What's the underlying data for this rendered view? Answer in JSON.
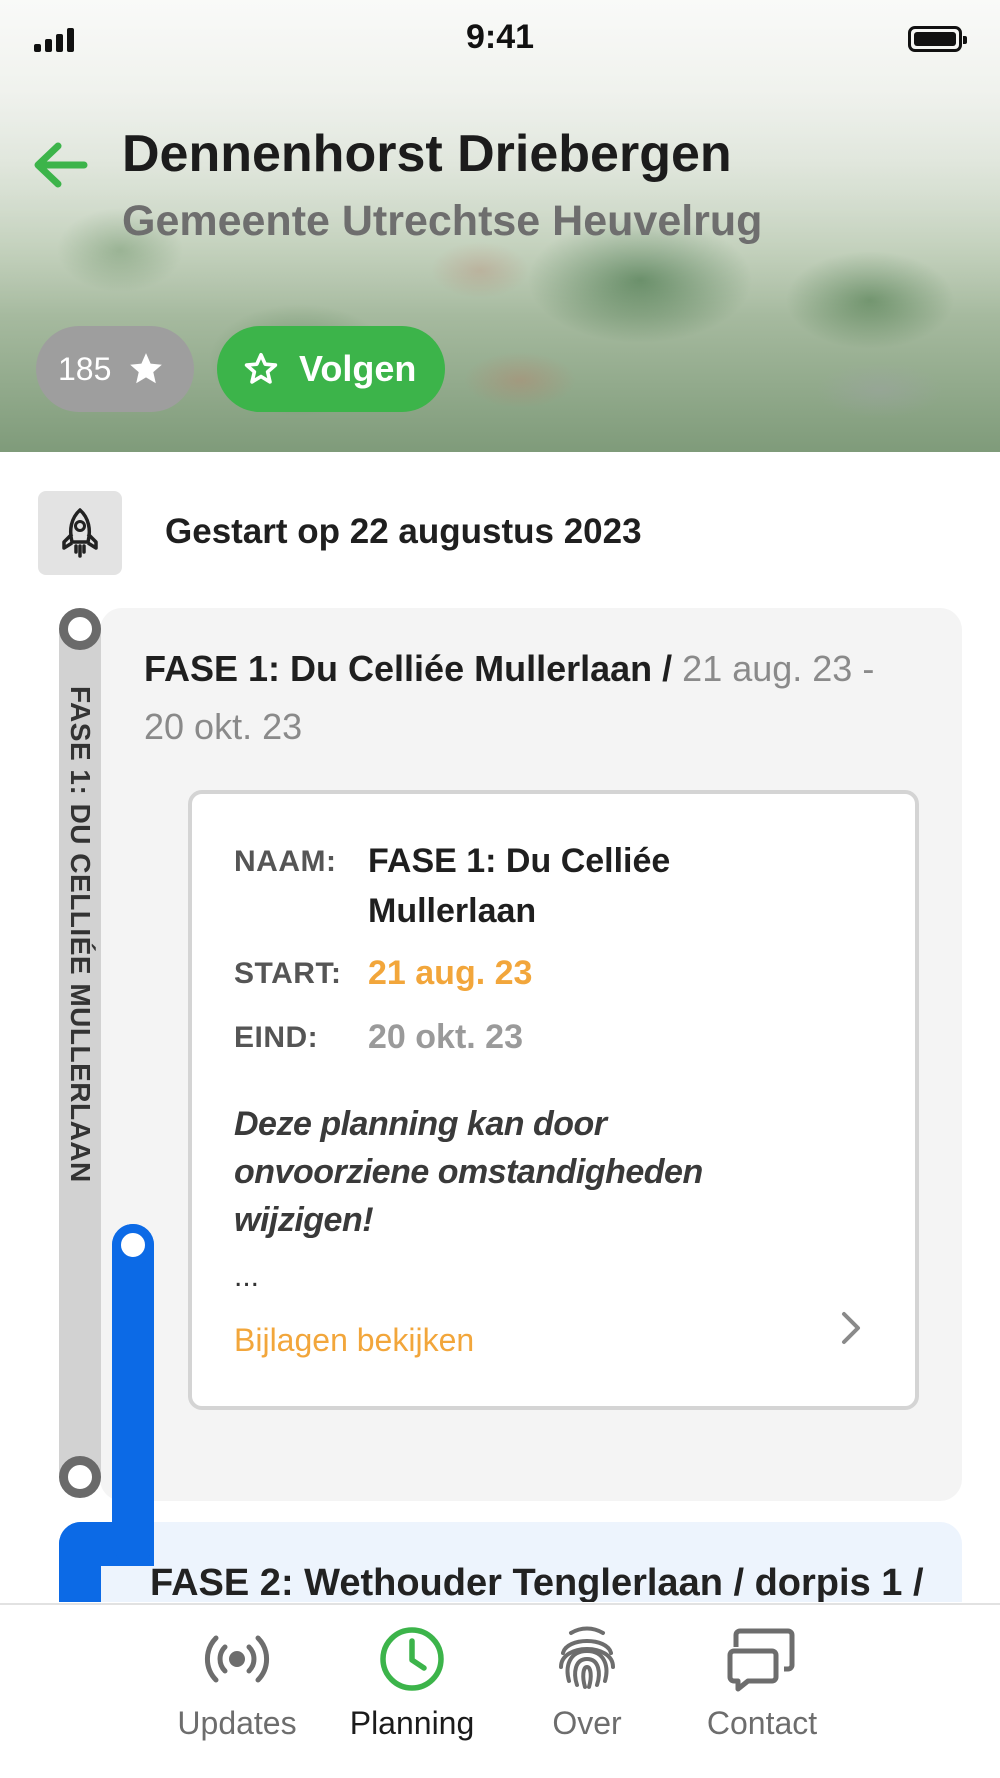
{
  "status_bar": {
    "time": "9:41"
  },
  "header": {
    "title": "Dennenhorst Driebergen",
    "subtitle": "Gemeente Utrechtse Heuvelrug",
    "followers_count": "185",
    "follow_label": "Volgen"
  },
  "started": {
    "text": "Gestart op 22 augustus 2023"
  },
  "phase": {
    "rail_label": "FASE 1: DU CELLIÉE MULLERLAAN",
    "heading_name": "FASE 1: Du Celliée Mullerlaan /",
    "heading_dates": "21 aug. 23 - 20 okt. 23",
    "detail": {
      "name_label": "NAAM:",
      "name_value": "FASE 1: Du Celliée Mullerlaan",
      "start_label": "START:",
      "start_value": "21 aug. 23",
      "end_label": "EIND:",
      "end_value": "20 okt. 23",
      "note": "Deze planning kan door onvoorziene omstandigheden wijzigen!",
      "ellipsis": "...",
      "attachments_link": "Bijlagen bekijken"
    }
  },
  "next_phase": {
    "heading_partial": "FASE 2: Wethouder Tenglerlaan / dorpis 1 /"
  },
  "tabbar": {
    "tabs": [
      {
        "label": "Updates",
        "icon": "broadcast-icon",
        "active": false
      },
      {
        "label": "Planning",
        "icon": "clock-icon",
        "active": true
      },
      {
        "label": "Over",
        "icon": "fingerprint-icon",
        "active": false
      },
      {
        "label": "Contact",
        "icon": "chat-icon",
        "active": false
      }
    ]
  },
  "colors": {
    "accent_green": "#3cb44a",
    "accent_orange": "#f2a63b",
    "timeline_blue": "#0c6ae6",
    "pill_gray": "#9e9e9e"
  }
}
